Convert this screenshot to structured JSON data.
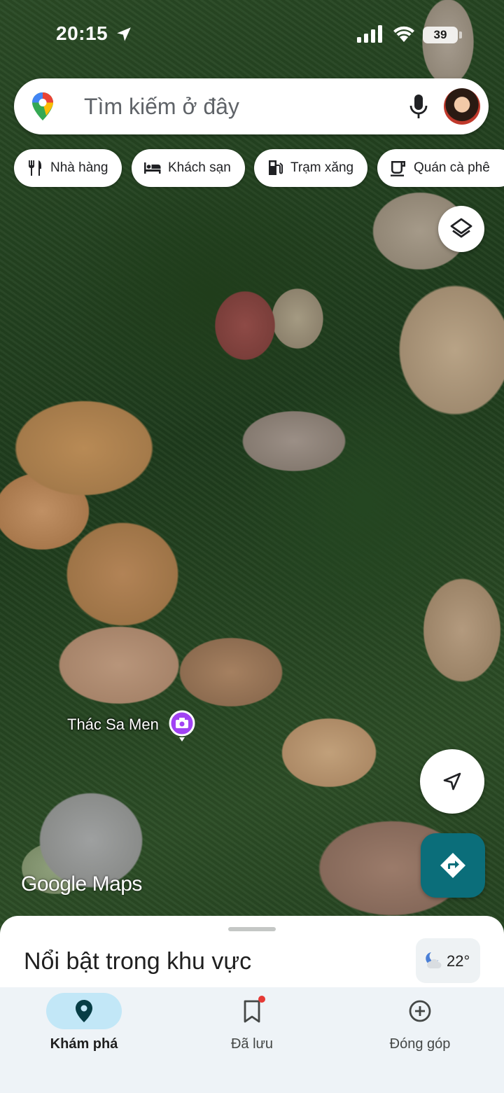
{
  "status_bar": {
    "time": "20:15",
    "battery": "39",
    "icons": [
      "location-arrow-icon",
      "signal-icon",
      "wifi-icon",
      "battery-icon"
    ]
  },
  "search": {
    "placeholder": "Tìm kiếm ở đây",
    "icons": [
      "google-maps-pin-icon",
      "mic-icon",
      "avatar"
    ]
  },
  "chips": [
    {
      "label": "Nhà hàng",
      "icon": "restaurant-icon"
    },
    {
      "label": "Khách sạn",
      "icon": "hotel-icon"
    },
    {
      "label": "Trạm xăng",
      "icon": "gas-station-icon"
    },
    {
      "label": "Quán cà phê",
      "icon": "coffee-icon"
    }
  ],
  "map": {
    "place_label": "Thác Sa Men",
    "place_icon": "camera-pin-icon",
    "watermark": "Google Maps",
    "layers_icon": "layers-icon",
    "locate_icon": "navigation-arrow-icon",
    "directions_icon": "directions-icon"
  },
  "sheet": {
    "title": "Nổi bật trong khu vực",
    "weather": {
      "temperature": "22°",
      "icon": "night-cloud-icon"
    }
  },
  "navbar": {
    "items": [
      {
        "label": "Khám phá",
        "icon": "explore-pin-icon",
        "active": true
      },
      {
        "label": "Đã lưu",
        "icon": "bookmark-icon",
        "active": false
      },
      {
        "label": "Đóng góp",
        "icon": "add-circle-icon",
        "active": false
      }
    ]
  },
  "colors": {
    "directions_button": "#0b6e7a",
    "nav_active_pill": "#c2e7f7",
    "notification_dot": "#e53935",
    "place_pin": "#a142f4"
  }
}
